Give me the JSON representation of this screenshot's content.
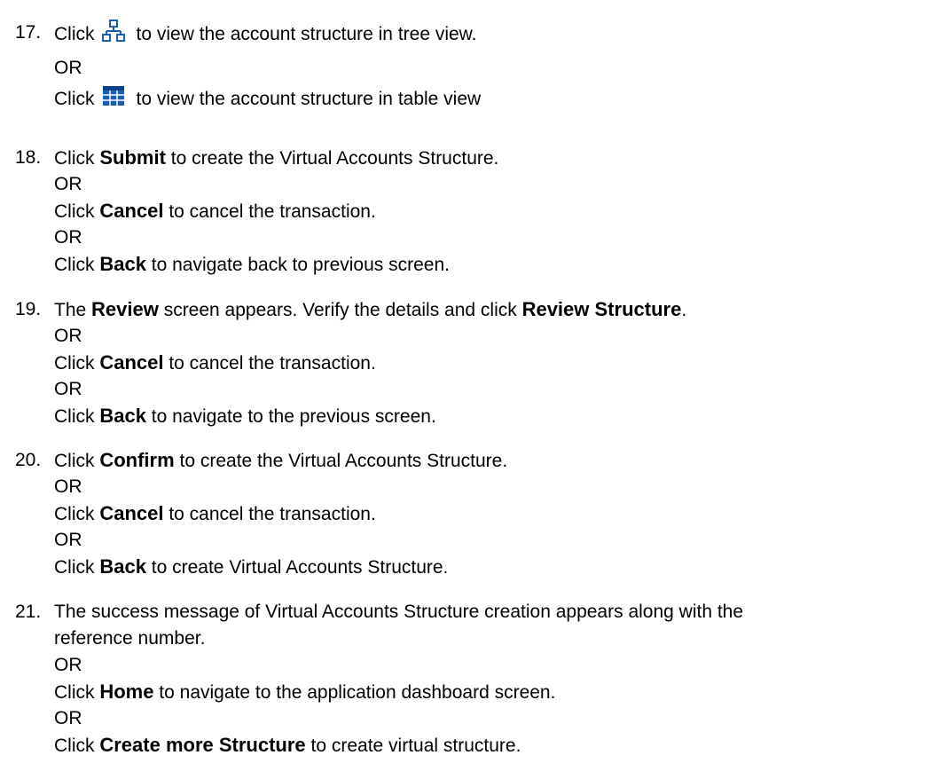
{
  "steps": [
    {
      "number": "17.",
      "lines": [
        {
          "pre": "Click",
          "icon": "tree-view-icon",
          "post": "to view the account structure in tree view."
        },
        {
          "text": "OR"
        },
        {
          "pre": "Click",
          "icon": "table-view-icon",
          "post": "to view the account structure in table view"
        }
      ]
    },
    {
      "number": "18.",
      "lines": [
        {
          "pre": "Click ",
          "bold": "Submit",
          "post": " to create the Virtual Accounts Structure."
        },
        {
          "text": "OR"
        },
        {
          "pre": "Click ",
          "bold": "Cancel",
          "post": " to cancel the transaction."
        },
        {
          "text": "OR"
        },
        {
          "pre": "Click ",
          "bold": "Back",
          "post": " to navigate back to previous screen."
        }
      ]
    },
    {
      "number": "19.",
      "lines": [
        {
          "pre": "The ",
          "bold": "Review",
          "mid": " screen appears. Verify the details and click ",
          "bold2": "Review Structure",
          "post": "."
        },
        {
          "text": "OR"
        },
        {
          "pre": "Click ",
          "bold": "Cancel",
          "post": " to cancel the transaction."
        },
        {
          "text": "OR"
        },
        {
          "pre": "Click ",
          "bold": "Back",
          "post": " to navigate to the previous screen."
        }
      ]
    },
    {
      "number": "20.",
      "lines": [
        {
          "pre": "Click ",
          "bold": "Confirm",
          "post": " to create the Virtual Accounts Structure."
        },
        {
          "text": "OR"
        },
        {
          "pre": "Click ",
          "bold": "Cancel",
          "post": " to cancel the transaction."
        },
        {
          "text": "OR"
        },
        {
          "pre": "Click ",
          "bold": "Back",
          "post": " to create Virtual Accounts Structure."
        }
      ]
    },
    {
      "number": "21.",
      "lines": [
        {
          "text": "The success message of Virtual Accounts Structure creation appears along with the"
        },
        {
          "text": "reference number."
        },
        {
          "text": "OR"
        },
        {
          "pre": "Click ",
          "bold": "Home",
          "post": " to navigate to the application dashboard screen."
        },
        {
          "text": "OR"
        },
        {
          "pre": "Click ",
          "bold": "Create more Structure",
          "post": " to create virtual structure."
        }
      ]
    }
  ],
  "colors": {
    "icon_blue": "#1a5fb4",
    "icon_dark": "#0d3f8a",
    "text": "#000000"
  }
}
